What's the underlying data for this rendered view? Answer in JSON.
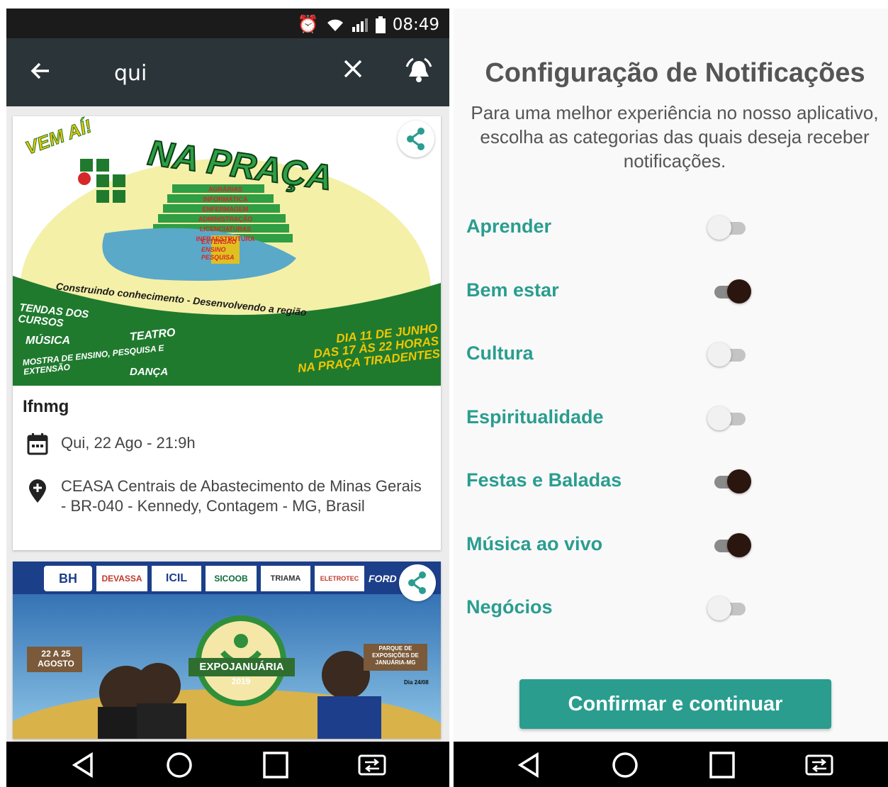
{
  "left_screen": {
    "status_bar": {
      "time": "08:49"
    },
    "app_bar": {
      "search_query": "qui"
    },
    "cards": [
      {
        "banner": {
          "headline_top": "VEM AÍ!",
          "headline": "NA PRAÇA",
          "areas": [
            "AGRÁRIAS",
            "INFORMÁTICA",
            "ENFERMAGEM",
            "ADMINISTRAÇÃO",
            "LICENCIATURAS",
            "INFRAESTRUTURA"
          ],
          "pillars": [
            "EXTENSÃO",
            "ENSINO",
            "PESQUISA"
          ],
          "slogan": "Construindo conhecimento - Desenvolvendo a região",
          "activities_1": "TENDAS DOS CURSOS",
          "activities_2": "MÚSICA",
          "activities_3": "TEATRO",
          "activities_4": "MOSTRA DE ENSINO, PESQUISA E EXTENSÃO",
          "activities_5": "DANÇA",
          "when_line1": "DIA 11 DE JUNHO",
          "when_line2": "DAS 17 ÀS 22 HORAS",
          "when_line3": "NA PRAÇA TIRADENTES"
        },
        "title": "Ifnmg",
        "date": "Qui, 22  Ago - 21:9h",
        "location": "CEASA Centrais de Abastecimento de Minas Gerais - BR-040 - Kennedy, Contagem - MG, Brasil"
      },
      {
        "banner": {
          "sponsors": [
            "BH",
            "DEVASSA",
            "ICIL",
            "SICOOB",
            "TRIAMA",
            "ELETROTEC",
            "FORD"
          ],
          "dates": "22 A 25 AGOSTO",
          "event_name": "EXPOJANUÁRIA",
          "year": "2019",
          "venue": "PARQUE DE EXPOSIÇÕES DE JANUÁRIA-MG",
          "day_tag": "Dia 24/08"
        }
      }
    ]
  },
  "right_screen": {
    "title": "Configuração de Notificações",
    "description": "Para uma melhor experiência no nosso aplicativo, escolha as categorias das quais deseja receber notificações.",
    "categories": [
      {
        "label": "Aprender",
        "enabled": false
      },
      {
        "label": "Bem estar",
        "enabled": true
      },
      {
        "label": "Cultura",
        "enabled": false
      },
      {
        "label": "Espiritualidade",
        "enabled": false
      },
      {
        "label": "Festas e Baladas",
        "enabled": true
      },
      {
        "label": "Música ao vivo",
        "enabled": true
      },
      {
        "label": "Negócios",
        "enabled": false
      }
    ],
    "confirm_label": "Confirmar e continuar"
  },
  "colors": {
    "accent": "#2a9d8f",
    "app_bar": "#2b3438",
    "toggle_on": "#2a150f",
    "banner_green": "#1f7a2e"
  },
  "icons": [
    "back-arrow-icon",
    "close-icon",
    "bell-icon",
    "share-icon",
    "calendar-icon",
    "location-pin-icon",
    "nav-back-icon",
    "nav-home-icon",
    "nav-recents-icon",
    "nav-switch-icon"
  ]
}
